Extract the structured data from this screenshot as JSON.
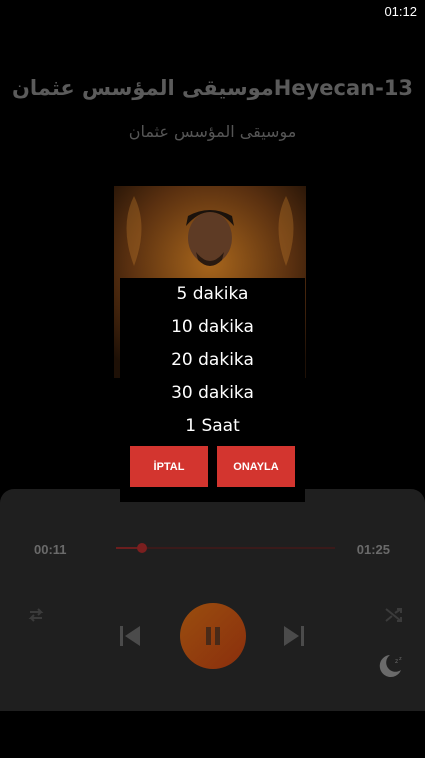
{
  "status": {
    "time": "01:12"
  },
  "song": {
    "title": "موسيقى المؤسس عثمانHeyecan-13",
    "artist": "موسيقى المؤسس عثمان"
  },
  "player": {
    "elapsed": "00:11",
    "total": "01:25",
    "progress": 0.12,
    "state": "playing"
  },
  "icons": {
    "repeat": "repeat-icon",
    "shuffle": "shuffle-icon",
    "previous": "skip-previous-icon",
    "next": "skip-next-icon",
    "pause": "pause-icon",
    "sleep": "sleep-timer-icon"
  },
  "sleep_dialog": {
    "options": [
      "5 dakika",
      "10 dakika",
      "20 dakika",
      "30 dakika",
      "1 Saat"
    ],
    "cancel_label": "İPTAL",
    "confirm_label": "ONAYLA"
  },
  "colors": {
    "accent": "#d3352f",
    "play_button": "#9a4e0e",
    "panel": "#1f1f1f"
  }
}
